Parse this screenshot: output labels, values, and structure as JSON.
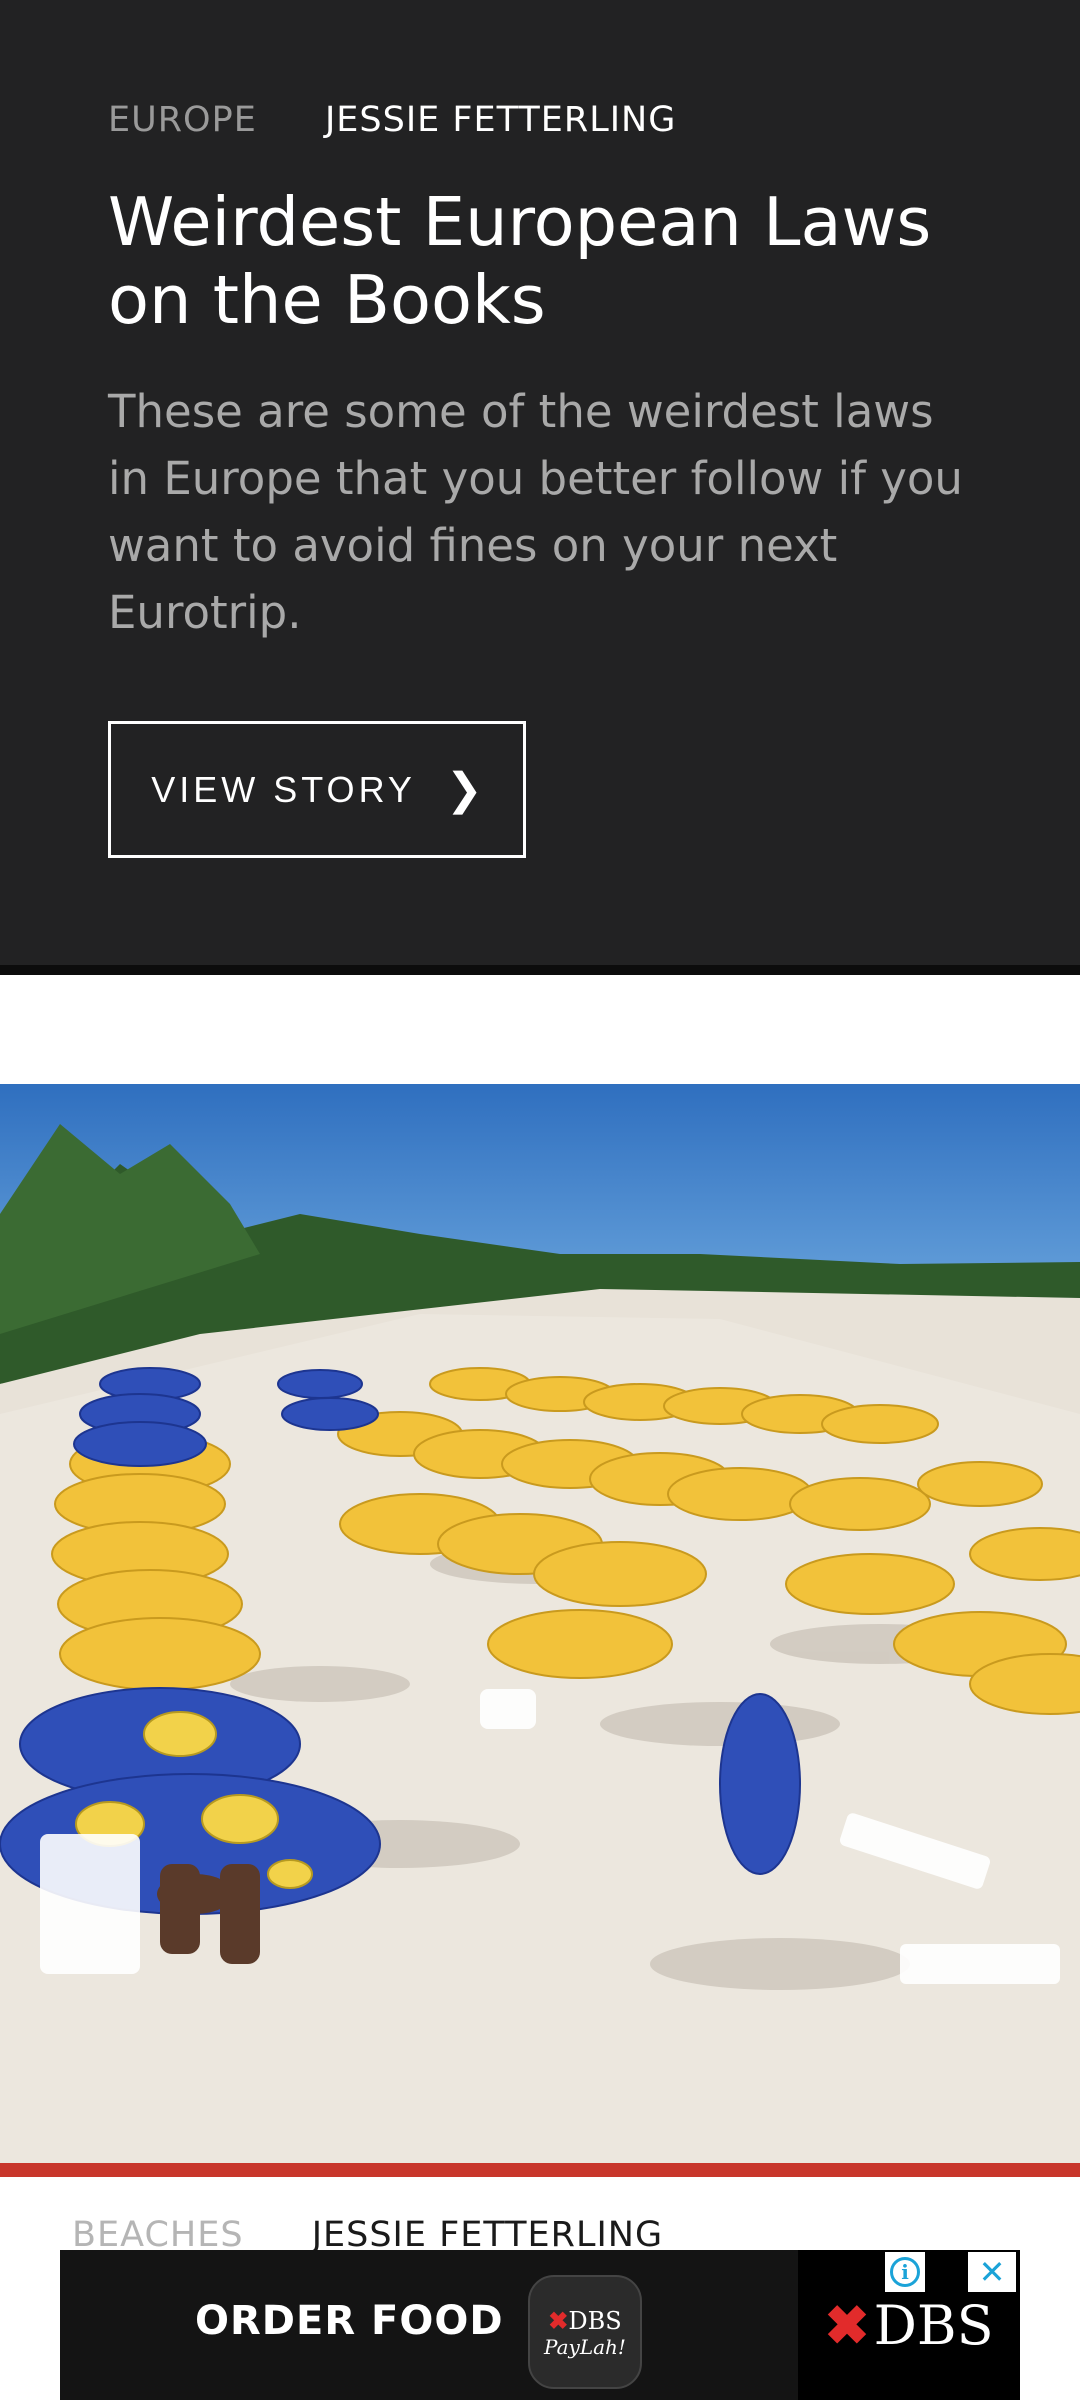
{
  "feature": {
    "category": "EUROPE",
    "author": "JESSIE FETTERLING",
    "title": "Weirdest European Laws on the Books",
    "description": "These are some of the weirdest laws in Europe that you better follow if you want to avoid fines on your next Eurotrip.",
    "button_label": "VIEW STORY",
    "button_icon": "chevron-right-icon",
    "button_glyph": "❯"
  },
  "next_story": {
    "image": "beach with blue and yellow Carib umbrellas",
    "category": "BEACHES",
    "author": "JESSIE FETTERLING"
  },
  "ad": {
    "text": "ORDER FOOD",
    "paylah_brand": "DBS",
    "paylah_label": "PayLah!",
    "logo_text": "DBS",
    "info_icon": "info-icon",
    "close_icon": "close-icon",
    "close_glyph": "✕"
  },
  "colors": {
    "hero_bg": "#222223",
    "accent_red": "#c8362b",
    "ad_bg": "#141414",
    "ad_icon_blue": "#1ba3d8"
  }
}
